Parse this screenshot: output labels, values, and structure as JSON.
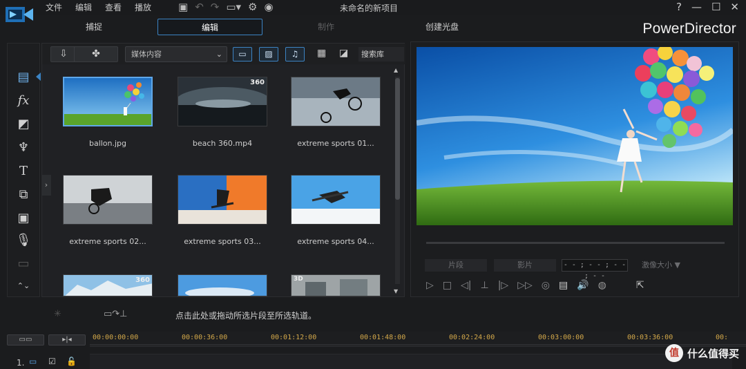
{
  "menubar": {
    "items": [
      "文件",
      "编辑",
      "查看",
      "播放"
    ],
    "project_title": "未命名的新项目",
    "window_controls": [
      "?",
      "—",
      "☐",
      "✕"
    ]
  },
  "modes": {
    "tabs": [
      {
        "label": "捕捉",
        "state": "normal"
      },
      {
        "label": "编辑",
        "state": "active"
      },
      {
        "label": "制作",
        "state": "disabled"
      },
      {
        "label": "创建光盘",
        "state": "normal"
      }
    ],
    "brand": "PowerDirector"
  },
  "library": {
    "media_select": "媒体内容",
    "search_label": "搜索库",
    "items": [
      {
        "label": "ballon.jpg",
        "badge": "",
        "selected": true
      },
      {
        "label": "beach 360.mp4",
        "badge": "360",
        "selected": false
      },
      {
        "label": "extreme sports 01...",
        "badge": "",
        "selected": false
      },
      {
        "label": "extreme sports 02...",
        "badge": "",
        "selected": false
      },
      {
        "label": "extreme sports 03...",
        "badge": "",
        "selected": false
      },
      {
        "label": "extreme sports 04...",
        "badge": "",
        "selected": false
      },
      {
        "label": "",
        "badge": "360",
        "selected": false
      },
      {
        "label": "",
        "badge": "",
        "selected": false
      },
      {
        "label": "",
        "badge": "3D",
        "selected": false
      }
    ]
  },
  "preview": {
    "chip1": "片段",
    "chip2": "影片",
    "timecode": "- - ; - - ; - - ; - -",
    "quality": "激像大小 ▼"
  },
  "timeline": {
    "hint": "点击此处或拖动所选片段至所选轨道。",
    "ruler_labels": [
      "00:00:00:00",
      "00:00:36:00",
      "00:01:12:00",
      "00:01:48:00",
      "00:02:24:00",
      "00:03:00:00",
      "00:03:36:00",
      "00:"
    ],
    "track_number": "1."
  },
  "watermark": {
    "icon": "值",
    "text": "什么值得买"
  },
  "colors": {
    "accent": "#3c84c4",
    "ruler_text": "#d4a94a"
  }
}
